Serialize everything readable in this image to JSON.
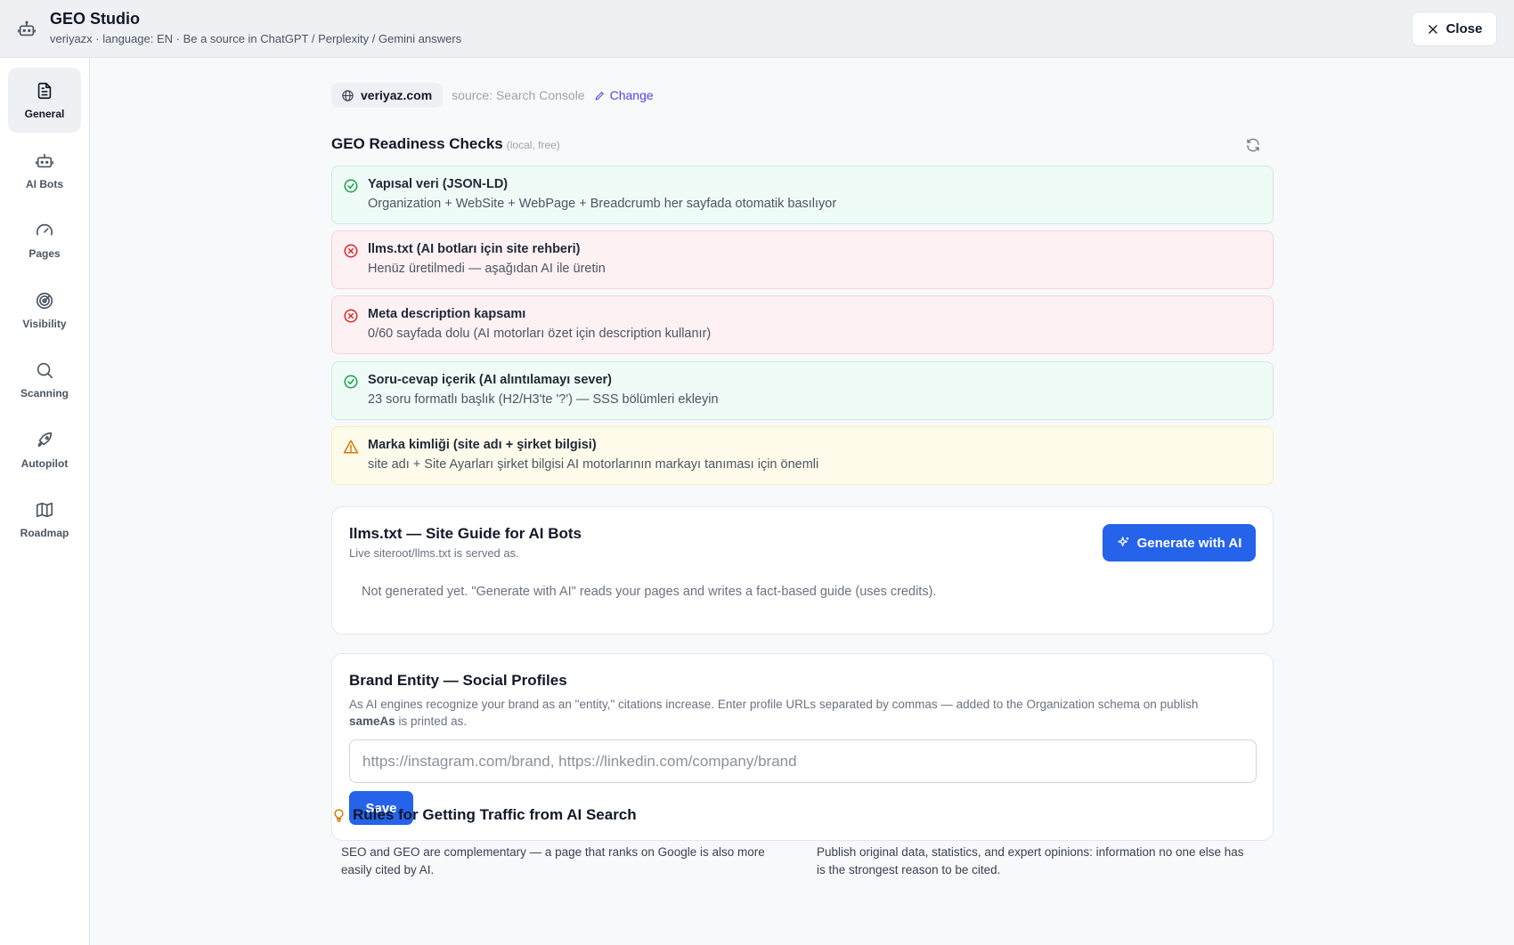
{
  "header": {
    "title": "GEO Studio",
    "subtitle": "veriyazx · language: EN · Be a source in ChatGPT / Perplexity / Gemini answers",
    "close_label": "Close"
  },
  "sidebar": {
    "items": [
      {
        "label": "General",
        "icon": "document-icon",
        "active": true
      },
      {
        "label": "AI Bots",
        "icon": "robot-icon"
      },
      {
        "label": "Pages",
        "icon": "gauge-icon"
      },
      {
        "label": "Visibility",
        "icon": "target-icon"
      },
      {
        "label": "Scanning",
        "icon": "search-icon"
      },
      {
        "label": "Autopilot",
        "icon": "rocket-icon"
      },
      {
        "label": "Roadmap",
        "icon": "map-icon"
      }
    ]
  },
  "site": {
    "domain": "veriyaz.com",
    "source": "source: Search Console",
    "change_label": "Change"
  },
  "checks": {
    "title": "GEO Readiness Checks",
    "note": "(local, free)",
    "items": [
      {
        "status": "ok",
        "title": "Yapısal veri (JSON-LD)",
        "desc": "Organization + WebSite + WebPage + Breadcrumb her sayfada otomatik basılıyor"
      },
      {
        "status": "bad",
        "title": "llms.txt (AI botları için site rehberi)",
        "desc": "Henüz üretilmedi — aşağıdan AI ile üretin"
      },
      {
        "status": "bad",
        "title": "Meta description kapsamı",
        "desc": "0/60 sayfada dolu (AI motorları özet için description kullanır)"
      },
      {
        "status": "ok",
        "title": "Soru-cevap içerik (AI alıntılamayı sever)",
        "desc": "23 soru formatlı başlık (H2/H3'te '?') — SSS bölümleri ekleyin"
      },
      {
        "status": "warn",
        "title": "Marka kimliği (site adı + şirket bilgisi)",
        "desc": "site adı + Site Ayarları şirket bilgisi AI motorlarının markayı tanıması için önemli"
      }
    ]
  },
  "llms": {
    "title": "llms.txt — Site Guide for AI Bots",
    "subtitle": "Live siteroot/llms.txt is served as.",
    "generate_label": "Generate with AI",
    "empty_note": "Not generated yet. \"Generate with AI\" reads your pages and writes a fact-based guide (uses credits)."
  },
  "brand": {
    "title": "Brand Entity — Social Profiles",
    "desc_line": "As AI engines recognize your brand as an \"entity,\" citations increase. Enter profile URLs separated by commas — added to the Organization schema on publish",
    "desc_bold": "sameAs",
    "desc_tail": " is printed as.",
    "input_placeholder": "https://instagram.com/brand, https://linkedin.com/company/brand",
    "input_value": "",
    "save_label": "Save"
  },
  "rules": {
    "title": "Rules for Getting Traffic from AI Search",
    "items": [
      "SEO and GEO are complementary — a page that ranks on Google is also more easily cited by AI.",
      "Publish original data, statistics, and expert opinions: information no one else has is the strongest reason to be cited."
    ]
  }
}
